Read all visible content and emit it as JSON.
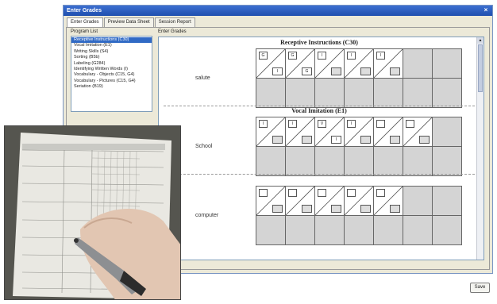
{
  "window": {
    "title": "Enter Grades",
    "close_glyph": "×"
  },
  "tabs": [
    {
      "label": "Enter Grades",
      "active": true
    },
    {
      "label": "Preview Data Sheet",
      "active": false
    },
    {
      "label": "Session Report",
      "active": false
    }
  ],
  "program_list": {
    "label": "Program List",
    "items": [
      {
        "label": "Receptive Instructions (C30)",
        "selected": true
      },
      {
        "label": "Vocal Imitation (E1)",
        "selected": false
      },
      {
        "label": "Writing Skills (S4)",
        "selected": false
      },
      {
        "label": "Sorting (B5b)",
        "selected": false
      },
      {
        "label": "Labeling (G284)",
        "selected": false
      },
      {
        "label": "Identifying Written Words (I)",
        "selected": false
      },
      {
        "label": "Vocabulary - Objects (C15, G4)",
        "selected": false
      },
      {
        "label": "Vocabulary - Pictures (C15, G4)",
        "selected": false
      },
      {
        "label": "Seriation (B19)",
        "selected": false
      }
    ]
  },
  "enter_grades": {
    "label": "Enter Grades",
    "sections": [
      {
        "title": "Receptive Instructions (C30)",
        "word": "salute",
        "cells": [
          {
            "top": "G",
            "bottom": "I"
          },
          {
            "top": "G",
            "bottom": "G"
          },
          {
            "top": "I",
            "bottom": ""
          },
          {
            "top": "I",
            "bottom": ""
          },
          {
            "top": "I",
            "bottom": ""
          }
        ]
      },
      {
        "title": "Vocal Imitation (E1)",
        "word": "School",
        "cells": [
          {
            "top": "I",
            "bottom": ""
          },
          {
            "top": "I",
            "bottom": ""
          },
          {
            "top": "V",
            "bottom": "I"
          },
          {
            "top": "I",
            "bottom": ""
          },
          {
            "top": "",
            "bottom": ""
          },
          {
            "top": "",
            "bottom": ""
          }
        ]
      },
      {
        "title": "",
        "word": "computer",
        "cells": [
          {
            "top": "",
            "bottom": ""
          },
          {
            "top": "",
            "bottom": ""
          },
          {
            "top": "",
            "bottom": ""
          },
          {
            "top": "",
            "bottom": ""
          },
          {
            "top": "",
            "bottom": ""
          }
        ]
      }
    ]
  },
  "save_label": "Save",
  "photo": {
    "subject": "hand-writing-with-digital-pen-on-data-sheet"
  },
  "colors": {
    "titlebar": "#2a5cc0",
    "selection": "#316ac5",
    "window_bg": "#ece9d8"
  }
}
